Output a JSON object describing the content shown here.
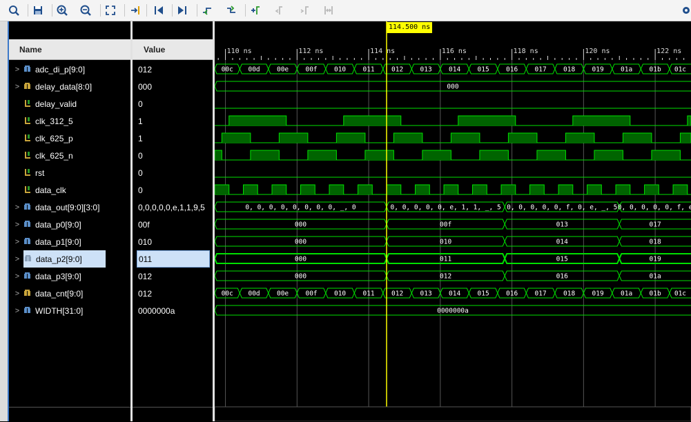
{
  "toolbar": {
    "icons": [
      "search-icon",
      "save-icon",
      "zoom-in-icon",
      "zoom-out-icon",
      "zoom-fit-icon",
      "go-to-cursor-icon",
      "go-to-start-icon",
      "go-to-end-icon",
      "previous-transition-icon",
      "next-transition-icon",
      "add-marker-icon",
      "previous-marker-icon",
      "next-marker-icon",
      "swap-cursors-icon",
      "settings-icon"
    ]
  },
  "headers": {
    "name": "Name",
    "value": "Value"
  },
  "cursor": {
    "label": "114.500 ns",
    "time_ns": 114.5
  },
  "timeline": {
    "start_ns": 109.7,
    "end_ns": 123.0,
    "major_ticks": [
      {
        "t": 110,
        "label": "110 ns"
      },
      {
        "t": 112,
        "label": "112 ns"
      },
      {
        "t": 114,
        "label": "114 ns"
      },
      {
        "t": 116,
        "label": "116 ns"
      },
      {
        "t": 118,
        "label": "118 ns"
      },
      {
        "t": 120,
        "label": "120 ns"
      },
      {
        "t": 122,
        "label": "122 ns"
      }
    ]
  },
  "signals": [
    {
      "name": "adc_di_p[9:0]",
      "value": "012",
      "bus": true,
      "icon": "bus",
      "color": "#5b8fc9",
      "segs": [
        {
          "s": 109.7,
          "e": 110.4,
          "v": "00c"
        },
        {
          "s": 110.4,
          "e": 111.2,
          "v": "00d"
        },
        {
          "s": 111.2,
          "e": 112.0,
          "v": "00e"
        },
        {
          "s": 112.0,
          "e": 112.8,
          "v": "00f"
        },
        {
          "s": 112.8,
          "e": 113.6,
          "v": "010"
        },
        {
          "s": 113.6,
          "e": 114.4,
          "v": "011"
        },
        {
          "s": 114.4,
          "e": 115.2,
          "v": "012"
        },
        {
          "s": 115.2,
          "e": 116.0,
          "v": "013"
        },
        {
          "s": 116.0,
          "e": 116.8,
          "v": "014"
        },
        {
          "s": 116.8,
          "e": 117.6,
          "v": "015"
        },
        {
          "s": 117.6,
          "e": 118.4,
          "v": "016"
        },
        {
          "s": 118.4,
          "e": 119.2,
          "v": "017"
        },
        {
          "s": 119.2,
          "e": 120.0,
          "v": "018"
        },
        {
          "s": 120.0,
          "e": 120.8,
          "v": "019"
        },
        {
          "s": 120.8,
          "e": 121.6,
          "v": "01a"
        },
        {
          "s": 121.6,
          "e": 122.4,
          "v": "01b"
        },
        {
          "s": 122.4,
          "e": 123.2,
          "v": "01c"
        }
      ]
    },
    {
      "name": "delay_data[8:0]",
      "value": "000",
      "bus": true,
      "icon": "bus",
      "color": "#c9a53b",
      "segs": [
        {
          "s": 109.7,
          "e": 123.2,
          "v": "000"
        }
      ]
    },
    {
      "name": "delay_valid",
      "value": "0",
      "bus": false,
      "icon": "wire",
      "clk": null,
      "level": 0
    },
    {
      "name": "clk_312_5",
      "value": "1",
      "bus": false,
      "icon": "wire",
      "clk": {
        "period": 3.2,
        "high_start": 110.1,
        "duty": 0.5
      }
    },
    {
      "name": "clk_625_p",
      "value": "1",
      "bus": false,
      "icon": "wire",
      "clk": {
        "period": 1.6,
        "high_start": 109.9,
        "duty": 0.5
      }
    },
    {
      "name": "clk_625_n",
      "value": "0",
      "bus": false,
      "icon": "wire",
      "clk": {
        "period": 1.6,
        "high_start": 109.1,
        "duty": 0.5
      }
    },
    {
      "name": "rst",
      "value": "0",
      "bus": false,
      "icon": "wire",
      "clk": null,
      "level": 0
    },
    {
      "name": "data_clk",
      "value": "0",
      "bus": false,
      "icon": "wire",
      "clk": {
        "period": 0.8,
        "high_start": 109.7,
        "duty": 0.5
      }
    },
    {
      "name": "data_out[9:0][3:0]",
      "value": "0,0,0,0,0,e,1,1,9,5",
      "bus": true,
      "icon": "bus",
      "color": "#5b8fc9",
      "segs": [
        {
          "s": 109.7,
          "e": 114.5,
          "v": "0, 0, 0, 0, 0, 0, 0, 0, _, 0"
        },
        {
          "s": 114.5,
          "e": 117.8,
          "v": "0, 0, 0, 0, 0, e, 1, 1, _, 5"
        },
        {
          "s": 117.8,
          "e": 121.0,
          "v": "0, 0, 0, 0, 0, f, 0, e, _, 5"
        },
        {
          "s": 121.0,
          "e": 123.2,
          "v": "0, 0, 0, 0, 0, f, e"
        }
      ]
    },
    {
      "name": "data_p0[9:0]",
      "value": "00f",
      "bus": true,
      "icon": "bus",
      "color": "#5b8fc9",
      "segs": [
        {
          "s": 109.7,
          "e": 114.5,
          "v": "000"
        },
        {
          "s": 114.5,
          "e": 117.8,
          "v": "00f"
        },
        {
          "s": 117.8,
          "e": 121.0,
          "v": "013"
        },
        {
          "s": 121.0,
          "e": 123.2,
          "v": "017"
        }
      ]
    },
    {
      "name": "data_p1[9:0]",
      "value": "010",
      "bus": true,
      "icon": "bus",
      "color": "#5b8fc9",
      "segs": [
        {
          "s": 109.7,
          "e": 114.5,
          "v": "000"
        },
        {
          "s": 114.5,
          "e": 117.8,
          "v": "010"
        },
        {
          "s": 117.8,
          "e": 121.0,
          "v": "014"
        },
        {
          "s": 121.0,
          "e": 123.2,
          "v": "018"
        }
      ]
    },
    {
      "name": "data_p2[9:0]",
      "value": "011",
      "bus": true,
      "icon": "bus",
      "color": "#8aa0b8",
      "selected": true,
      "segs": [
        {
          "s": 109.7,
          "e": 114.5,
          "v": "000"
        },
        {
          "s": 114.5,
          "e": 117.8,
          "v": "011"
        },
        {
          "s": 117.8,
          "e": 121.0,
          "v": "015"
        },
        {
          "s": 121.0,
          "e": 123.2,
          "v": "019"
        }
      ]
    },
    {
      "name": "data_p3[9:0]",
      "value": "012",
      "bus": true,
      "icon": "bus",
      "color": "#5b8fc9",
      "segs": [
        {
          "s": 109.7,
          "e": 114.5,
          "v": "000"
        },
        {
          "s": 114.5,
          "e": 117.8,
          "v": "012"
        },
        {
          "s": 117.8,
          "e": 121.0,
          "v": "016"
        },
        {
          "s": 121.0,
          "e": 123.2,
          "v": "01a"
        }
      ]
    },
    {
      "name": "data_cnt[9:0]",
      "value": "012",
      "bus": true,
      "icon": "bus",
      "color": "#c9a53b",
      "segs": [
        {
          "s": 109.7,
          "e": 110.4,
          "v": "00c"
        },
        {
          "s": 110.4,
          "e": 111.2,
          "v": "00d"
        },
        {
          "s": 111.2,
          "e": 112.0,
          "v": "00e"
        },
        {
          "s": 112.0,
          "e": 112.8,
          "v": "00f"
        },
        {
          "s": 112.8,
          "e": 113.6,
          "v": "010"
        },
        {
          "s": 113.6,
          "e": 114.4,
          "v": "011"
        },
        {
          "s": 114.4,
          "e": 115.2,
          "v": "012"
        },
        {
          "s": 115.2,
          "e": 116.0,
          "v": "013"
        },
        {
          "s": 116.0,
          "e": 116.8,
          "v": "014"
        },
        {
          "s": 116.8,
          "e": 117.6,
          "v": "015"
        },
        {
          "s": 117.6,
          "e": 118.4,
          "v": "016"
        },
        {
          "s": 118.4,
          "e": 119.2,
          "v": "017"
        },
        {
          "s": 119.2,
          "e": 120.0,
          "v": "018"
        },
        {
          "s": 120.0,
          "e": 120.8,
          "v": "019"
        },
        {
          "s": 120.8,
          "e": 121.6,
          "v": "01a"
        },
        {
          "s": 121.6,
          "e": 122.4,
          "v": "01b"
        },
        {
          "s": 122.4,
          "e": 123.2,
          "v": "01c"
        }
      ]
    },
    {
      "name": "WIDTH[31:0]",
      "value": "0000000a",
      "bus": true,
      "icon": "bus",
      "color": "#5b8fc9",
      "segs": [
        {
          "s": 109.7,
          "e": 123.2,
          "v": "0000000a"
        }
      ]
    }
  ],
  "colors": {
    "wave": "#00e000",
    "fill": "#006400",
    "cursor": "#ffff00",
    "grid": "#555555"
  }
}
